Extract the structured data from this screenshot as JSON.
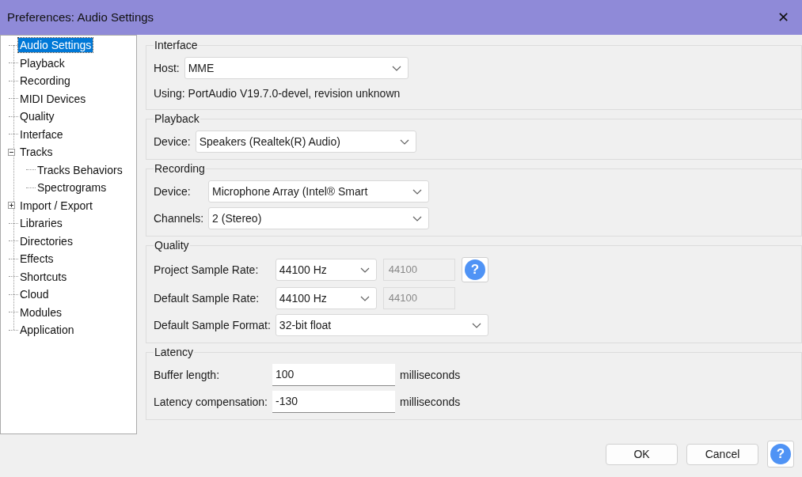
{
  "window": {
    "title": "Preferences: Audio Settings",
    "close": "✕"
  },
  "tree": [
    {
      "label": "Audio Settings",
      "selected": true
    },
    {
      "label": "Playback",
      "selected": false
    },
    {
      "label": "Recording",
      "selected": false
    },
    {
      "label": "MIDI Devices",
      "selected": false
    },
    {
      "label": "Quality",
      "selected": false
    },
    {
      "label": "Interface",
      "selected": false
    },
    {
      "label": "Tracks",
      "selected": false,
      "expanded": true,
      "children": [
        {
          "label": "Tracks Behaviors",
          "selected": false
        },
        {
          "label": "Spectrograms",
          "selected": false
        }
      ]
    },
    {
      "label": "Import / Export",
      "selected": false,
      "expanded": false
    },
    {
      "label": "Libraries",
      "selected": false
    },
    {
      "label": "Directories",
      "selected": false
    },
    {
      "label": "Effects",
      "selected": false
    },
    {
      "label": "Shortcuts",
      "selected": false
    },
    {
      "label": "Cloud",
      "selected": false
    },
    {
      "label": "Modules",
      "selected": false
    },
    {
      "label": "Application",
      "selected": false
    }
  ],
  "groups": [
    {
      "title": "Interface",
      "rows": [
        {
          "kind": "select",
          "label": "Host:",
          "value": "MME"
        },
        {
          "kind": "note",
          "text": "Using: PortAudio V19.7.0-devel, revision unknown"
        }
      ]
    },
    {
      "title": "Playback",
      "rows": [
        {
          "kind": "select",
          "label": "Device:",
          "value": "Speakers (Realtek(R) Audio)"
        }
      ]
    },
    {
      "title": "Recording",
      "rows": [
        {
          "kind": "select",
          "label": "Device:",
          "value": "Microphone Array (Intel® Smart"
        },
        {
          "kind": "select",
          "label": "Channels:",
          "value": "2 (Stereo)"
        }
      ]
    },
    {
      "title": "Quality",
      "rows": [
        {
          "kind": "rate",
          "label": "Project Sample Rate:",
          "value": "44100 Hz",
          "custom_value": "44100",
          "help": "?"
        },
        {
          "kind": "rate",
          "label": "Default Sample Rate:",
          "value": "44100 Hz",
          "custom_value": "44100"
        },
        {
          "kind": "select",
          "label": "Default Sample Format:",
          "value": "32-bit float"
        }
      ]
    },
    {
      "title": "Latency",
      "rows": [
        {
          "kind": "input",
          "label": "Buffer length:",
          "value": "100",
          "unit": "milliseconds"
        },
        {
          "kind": "input",
          "label": "Latency compensation:",
          "value": "-130",
          "unit": "milliseconds"
        }
      ]
    }
  ],
  "buttons": [
    {
      "kind": "text",
      "label": "OK"
    },
    {
      "kind": "text",
      "label": "Cancel"
    },
    {
      "kind": "help",
      "label": "?"
    }
  ]
}
